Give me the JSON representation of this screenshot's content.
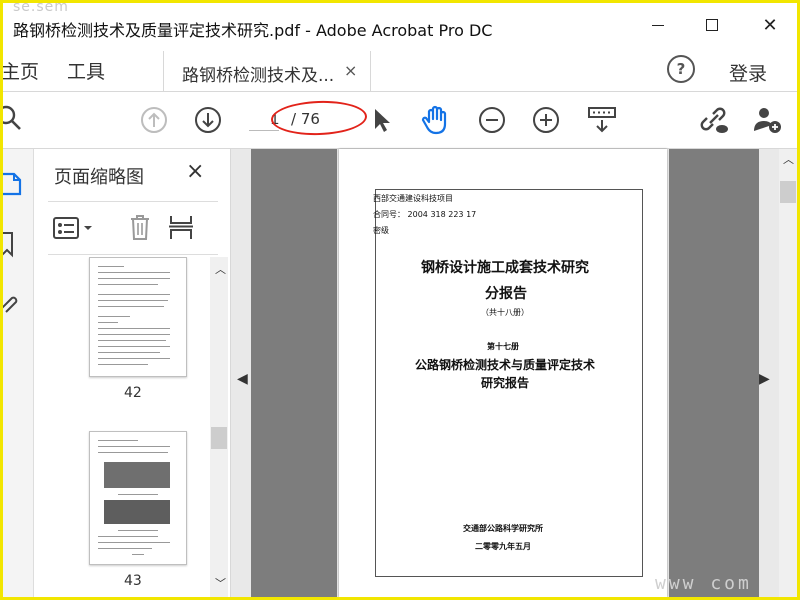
{
  "window": {
    "watermark_top": "se.sem",
    "title": "路钢桥检测技术及质量评定技术研究.pdf - Adobe Acrobat Pro DC"
  },
  "menubar": {
    "home": "主页",
    "tools": "工具",
    "doc_tab_label": "路钢桥检测技术及...",
    "doc_tab_close": "×",
    "help": "?",
    "login": "登录"
  },
  "toolbar": {
    "current_page": "1",
    "total_pages": "/ 76"
  },
  "thumbnails_panel": {
    "title": "页面缩略图",
    "close": "×",
    "pages": [
      {
        "number": "42"
      },
      {
        "number": "43"
      }
    ]
  },
  "document_page": {
    "line1": "西部交通建设科技项目",
    "line2": "合同号：  2004  318  223  17",
    "line3": "密级",
    "title": "钢桥设计施工成套技术研究",
    "subtitle": "分报告",
    "count": "（共十八册）",
    "volume": "第十七册",
    "report_title_1": "公路钢桥检测技术与质量评定技术",
    "report_title_2": "研究报告",
    "org": "交通部公路科学研究所",
    "date": "二零零九年五月"
  },
  "watermark_bottom": "www    com",
  "colors": {
    "frame_border": "#f2e600",
    "accent_blue": "#1473e6",
    "annotation_red": "#e2231a",
    "page_bg_gray": "#7d7d7d"
  },
  "icons": [
    "search-icon",
    "prev-page-icon",
    "next-page-icon",
    "select-tool-icon",
    "hand-tool-icon",
    "zoom-out-icon",
    "zoom-in-icon",
    "page-fit-icon",
    "share-link-icon",
    "add-user-icon",
    "bookmarks-icon",
    "thumbnails-icon",
    "attachments-icon",
    "thumbnail-options-icon",
    "delete-page-icon",
    "extract-pages-icon"
  ]
}
